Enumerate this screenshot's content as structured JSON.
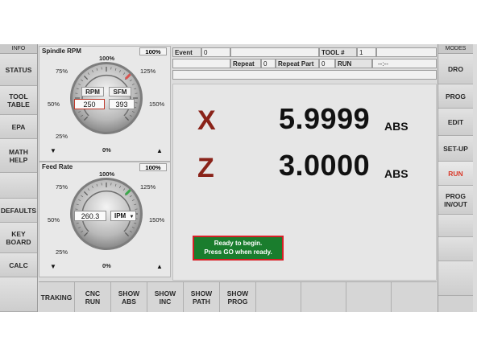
{
  "left_sidebar": {
    "header": "INFO",
    "buttons": [
      {
        "label": "STATUS",
        "active": false
      },
      {
        "label": "TOOL\nTABLE",
        "active": false
      },
      {
        "label": "EPA",
        "active": false
      },
      {
        "label": "MATH\nHELP",
        "active": false
      },
      {
        "label": "",
        "active": false
      },
      {
        "label": "DEFAULTS",
        "active": false
      },
      {
        "label": "KEY\nBOARD",
        "active": false
      },
      {
        "label": "CALC",
        "active": false
      },
      {
        "label": "",
        "active": false
      }
    ]
  },
  "right_sidebar": {
    "header": "MODES",
    "buttons": [
      {
        "label": "DRO",
        "active": false
      },
      {
        "label": "PROG",
        "active": false
      },
      {
        "label": "EDIT",
        "active": false
      },
      {
        "label": "SET-UP",
        "active": false
      },
      {
        "label": "RUN",
        "active": true
      },
      {
        "label": "PROG\nIN/OUT",
        "active": false
      },
      {
        "label": "",
        "active": false
      },
      {
        "label": "",
        "active": false
      },
      {
        "label": "",
        "active": false
      }
    ]
  },
  "spindle_gauge": {
    "title": "Spindle RPM",
    "percent_box": "100%",
    "scale": {
      "p0": "0%",
      "p25": "25%",
      "p50": "50%",
      "p75": "75%",
      "p100": "100%",
      "p125": "125%",
      "p150": "150%"
    },
    "rpm_label": "RPM",
    "sfm_label": "SFM",
    "rpm_value": "250",
    "sfm_value": "393",
    "down_arrow": "▼",
    "up_arrow": "▲",
    "needle_percent": 100,
    "needle_color": "#d9534f"
  },
  "feed_gauge": {
    "title": "Feed Rate",
    "percent_box": "100%",
    "scale": {
      "p0": "0%",
      "p25": "25%",
      "p50": "50%",
      "p75": "75%",
      "p100": "100%",
      "p125": "125%",
      "p150": "150%"
    },
    "feed_value": "260.3",
    "unit_select": "IPM",
    "down_arrow": "▼",
    "up_arrow": "▲",
    "needle_percent": 100,
    "needle_color": "#3aa84a"
  },
  "top_strip": {
    "event_label": "Event",
    "event_value": "0",
    "event_desc": "",
    "tool_label": "TOOL #",
    "tool_value": "1",
    "tool_extra": "",
    "repeat_label": "Repeat",
    "repeat_value": "0",
    "repeat_part_label": "Repeat Part",
    "repeat_part_value": "0",
    "run_label": "RUN",
    "time_value": "--:--"
  },
  "dro": {
    "x_axis": "X",
    "x_value": "5.9999",
    "x_mode": "ABS",
    "z_axis": "Z",
    "z_value": "3.0000",
    "z_mode": "ABS"
  },
  "status_message": {
    "line1": "Ready to begin.",
    "line2": "Press GO when ready."
  },
  "bottom_toolbar": {
    "buttons": [
      "TRAKING",
      "CNC\nRUN",
      "SHOW\nABS",
      "SHOW\nINC",
      "SHOW\nPATH",
      "SHOW\nPROG",
      "",
      "",
      "",
      ""
    ]
  },
  "colors": {
    "active_mode": "#d93a2b",
    "axis_letter": "#8a2319",
    "status_bg": "#1a7d2d",
    "status_border": "#d61f26"
  }
}
